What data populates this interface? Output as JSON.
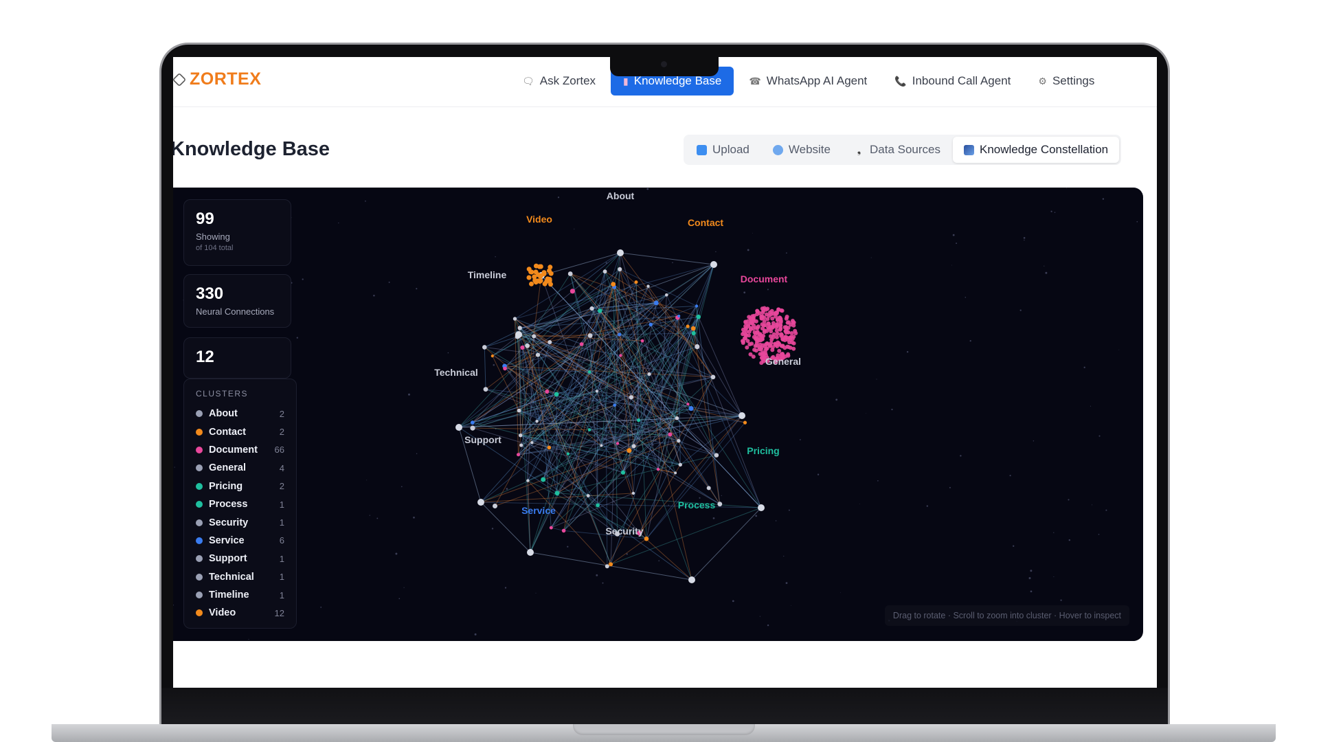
{
  "app": {
    "name": "ZORTEX"
  },
  "nav": {
    "items": [
      {
        "label": "Ask Zortex",
        "icon": "chat-bubble-icon",
        "active": false
      },
      {
        "label": "Knowledge Base",
        "icon": "books-icon",
        "active": true
      },
      {
        "label": "WhatsApp AI Agent",
        "icon": "whatsapp-icon",
        "active": false
      },
      {
        "label": "Inbound Call Agent",
        "icon": "phone-icon",
        "active": false
      },
      {
        "label": "Settings",
        "icon": "gear-icon",
        "active": false
      }
    ]
  },
  "page": {
    "title": "Knowledge Base",
    "tabs": [
      {
        "label": "Upload",
        "icon": "upload-icon",
        "active": false
      },
      {
        "label": "Website",
        "icon": "globe-icon",
        "active": false
      },
      {
        "label": "Data Sources",
        "icon": "pin-icon",
        "active": false
      },
      {
        "label": "Knowledge Constellation",
        "icon": "chart-icon",
        "active": true
      }
    ]
  },
  "stats": {
    "showing": {
      "value": "99",
      "label": "Showing",
      "sub": "of 104 total"
    },
    "connections": {
      "value": "330",
      "label": "Neural Connections"
    },
    "clusters": {
      "value": "12"
    }
  },
  "clusters_panel": {
    "title": "CLUSTERS",
    "items": [
      {
        "name": "About",
        "count": "2",
        "color": "#9aa0b4"
      },
      {
        "name": "Contact",
        "count": "2",
        "color": "#f28a1c"
      },
      {
        "name": "Document",
        "count": "66",
        "color": "#e8479b"
      },
      {
        "name": "General",
        "count": "4",
        "color": "#9aa0b4"
      },
      {
        "name": "Pricing",
        "count": "2",
        "color": "#1fbf9f"
      },
      {
        "name": "Process",
        "count": "1",
        "color": "#1fbf9f"
      },
      {
        "name": "Security",
        "count": "1",
        "color": "#9aa0b4"
      },
      {
        "name": "Service",
        "count": "6",
        "color": "#3a7cf0"
      },
      {
        "name": "Support",
        "count": "1",
        "color": "#9aa0b4"
      },
      {
        "name": "Technical",
        "count": "1",
        "color": "#9aa0b4"
      },
      {
        "name": "Timeline",
        "count": "1",
        "color": "#9aa0b4"
      },
      {
        "name": "Video",
        "count": "12",
        "color": "#f28a1c"
      }
    ]
  },
  "graph_labels": [
    {
      "name": "About",
      "color": "#c9ccd8"
    },
    {
      "name": "Video",
      "color": "#f28a1c"
    },
    {
      "name": "Contact",
      "color": "#f28a1c"
    },
    {
      "name": "Timeline",
      "color": "#c9ccd8"
    },
    {
      "name": "Document",
      "color": "#e8479b"
    },
    {
      "name": "General",
      "color": "#c9ccd8"
    },
    {
      "name": "Technical",
      "color": "#c9ccd8"
    },
    {
      "name": "Support",
      "color": "#c9ccd8"
    },
    {
      "name": "Pricing",
      "color": "#1fbf9f"
    },
    {
      "name": "Service",
      "color": "#3a7cf0"
    },
    {
      "name": "Process",
      "color": "#1fbf9f"
    },
    {
      "name": "Security",
      "color": "#c9ccd8"
    }
  ],
  "hint": "Drag to rotate · Scroll to zoom into cluster · Hover to inspect"
}
